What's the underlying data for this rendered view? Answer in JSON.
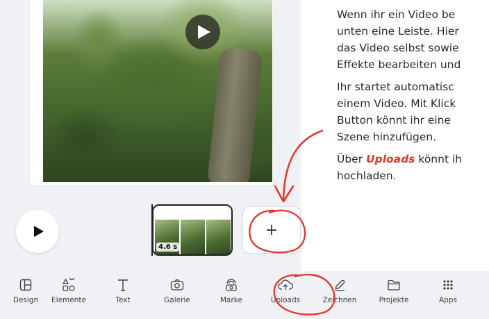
{
  "timeline": {
    "clip_duration": "4.6 s",
    "add_label": "+"
  },
  "nav": {
    "items": [
      {
        "label": "Design",
        "icon": "layout-icon"
      },
      {
        "label": "Elemente",
        "icon": "shapes-icon"
      },
      {
        "label": "Text",
        "icon": "text-icon"
      },
      {
        "label": "Galerie",
        "icon": "camera-icon"
      },
      {
        "label": "Marke",
        "icon": "brand-icon"
      },
      {
        "label": "Uploads",
        "icon": "cloud-upload-icon"
      },
      {
        "label": "Zeichnen",
        "icon": "draw-icon"
      },
      {
        "label": "Projekte",
        "icon": "folder-icon"
      },
      {
        "label": "Apps",
        "icon": "apps-grid-icon"
      }
    ]
  },
  "explanation": {
    "p1_l1": "Wenn ihr ein Video be",
    "p1_l2": "unten eine Leiste. Hier",
    "p1_l3": "das Video selbst sowie",
    "p1_l4": "Effekte bearbeiten und",
    "p2_l1": "Ihr startet automatisc",
    "p2_l2": "einem Video. Mit Klick",
    "p2_l3": "Button könnt ihr eine",
    "p2_l4": "Szene hinzufügen.",
    "p3_pre": "Über ",
    "p3_highlight": "Uploads",
    "p3_post": " könnt ih",
    "p3_l2": "hochladen."
  },
  "colors": {
    "annotation": "#e03a2f",
    "nav_bg": "#f0f1f4"
  }
}
